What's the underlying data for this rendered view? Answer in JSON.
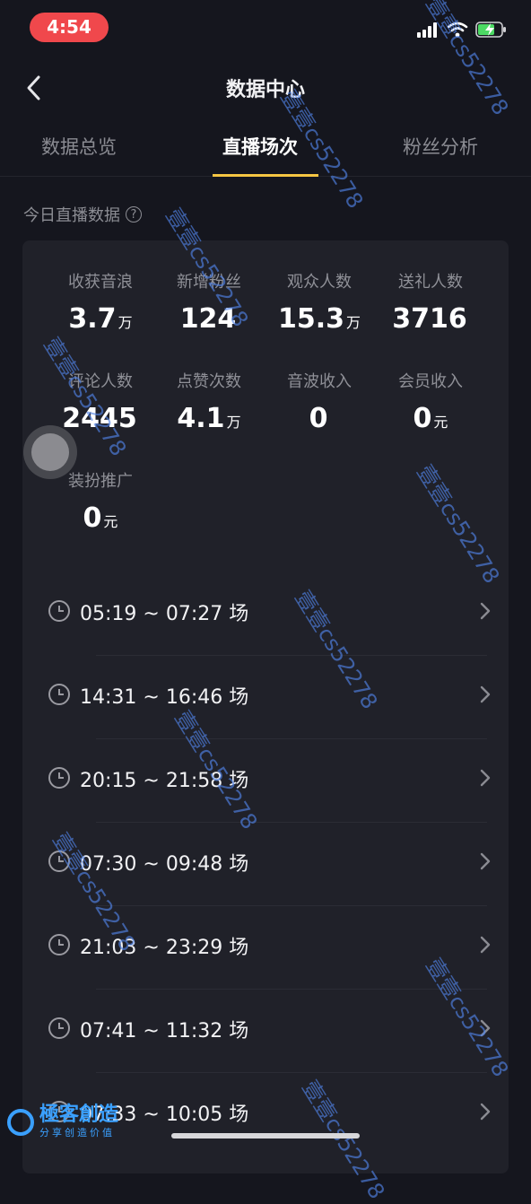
{
  "status": {
    "time": "4:54"
  },
  "nav": {
    "title": "数据中心"
  },
  "tabs": [
    {
      "label": "数据总览"
    },
    {
      "label": "直播场次"
    },
    {
      "label": "粉丝分析"
    }
  ],
  "section": {
    "title": "今日直播数据",
    "help": "?"
  },
  "metrics": [
    {
      "label": "收获音浪",
      "value": "3.7",
      "unit": "万"
    },
    {
      "label": "新增粉丝",
      "value": "124",
      "unit": ""
    },
    {
      "label": "观众人数",
      "value": "15.3",
      "unit": "万"
    },
    {
      "label": "送礼人数",
      "value": "3716",
      "unit": ""
    },
    {
      "label": "评论人数",
      "value": "2445",
      "unit": ""
    },
    {
      "label": "点赞次数",
      "value": "4.1",
      "unit": "万"
    },
    {
      "label": "音波收入",
      "value": "0",
      "unit": ""
    },
    {
      "label": "会员收入",
      "value": "0",
      "unit": "元"
    },
    {
      "label": "装扮推广",
      "value": "0",
      "unit": "元"
    }
  ],
  "sessions": [
    {
      "range": "05:19 ~ 07:27 场"
    },
    {
      "range": "14:31 ~ 16:46 场"
    },
    {
      "range": "20:15 ~ 21:58 场"
    },
    {
      "range": "07:30 ~ 09:48 场"
    },
    {
      "range": "21:03 ~ 23:29 场"
    },
    {
      "range": "07:41 ~ 11:32 场"
    },
    {
      "range": "07:33 ~ 10:05 场"
    }
  ],
  "watermark": {
    "text": "壹壹cs52278"
  },
  "brand": {
    "name": "極客創造",
    "slogan": "分享创造价值"
  },
  "colors": {
    "accent": "#f5c543",
    "time_pill": "#f0484c",
    "background": "#15161e",
    "card": "#202129"
  }
}
